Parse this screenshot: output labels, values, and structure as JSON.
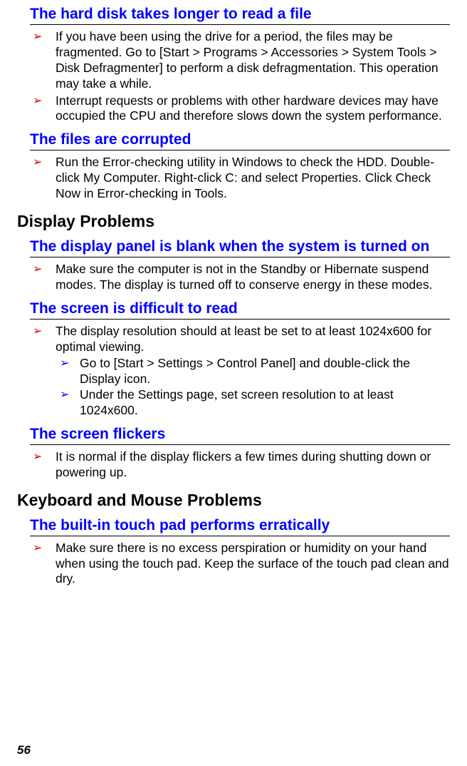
{
  "sections": {
    "s1": {
      "title": "The hard disk takes longer to read a file",
      "items": [
        "If you have been using the drive for a period, the files may be fragmented. Go to [Start > Programs > Accessories > System Tools > Disk Defragmenter] to perform a disk defragmentation. This operation may take a while.",
        "Interrupt requests or problems with other hardware devices may have occupied the CPU and therefore slows down the system performance."
      ]
    },
    "s2": {
      "title": "The files are corrupted",
      "items": [
        "Run the Error-checking utility in Windows to check the HDD. Double-click My Computer. Right-click C: and select Properties. Click Check Now in Error-checking in Tools."
      ]
    },
    "h1": "Display Problems",
    "s3": {
      "title": "The display panel is blank when the system is turned on",
      "items": [
        "Make sure the computer is not in the Standby or Hibernate suspend modes. The display is turned off to conserve energy in these modes."
      ]
    },
    "s4": {
      "title": "The screen is difficult to read",
      "items": [
        "The display resolution should at least be set to at least 1024x600 for optimal viewing."
      ],
      "nested": [
        "Go to [Start > Settings > Control Panel] and double-click the Display icon.",
        "Under the Settings page, set screen resolution to at least 1024x600."
      ]
    },
    "s5": {
      "title": "The screen flickers",
      "items": [
        "It is normal if the display flickers a few times during shutting down or powering up."
      ]
    },
    "h2": "Keyboard and Mouse Problems",
    "s6": {
      "title": "The built-in touch pad performs erratically",
      "items": [
        "Make sure there is no excess perspiration or humidity on your hand when using the touch pad. Keep the surface of the touch pad clean and dry."
      ]
    }
  },
  "pageNumber": "56",
  "bulletGlyph": "➢"
}
